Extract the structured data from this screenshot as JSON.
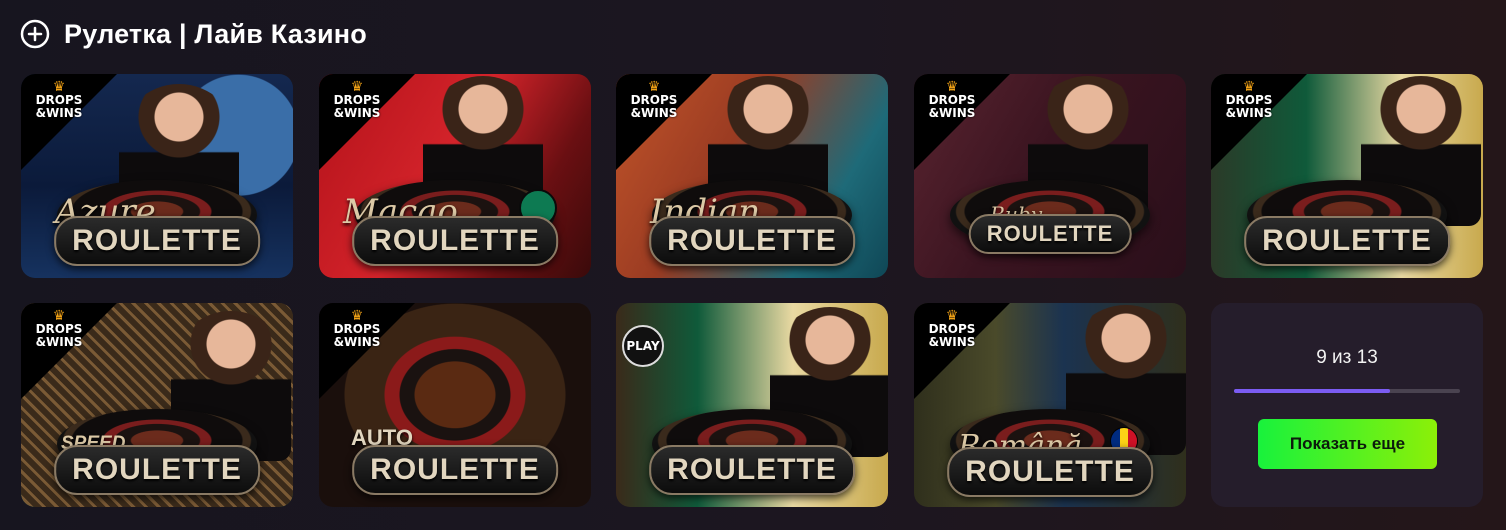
{
  "header": {
    "title": "Рулетка | Лайв Казино",
    "icon": "add-circle-icon"
  },
  "badges": {
    "drops_wins": "DROPS &WINS",
    "play": "PLAY"
  },
  "games": [
    {
      "prefix": "Azure",
      "title": "ROULETTE",
      "badge": "drops-wins"
    },
    {
      "prefix": "Macao",
      "title": "ROULETTE",
      "badge": "drops-wins"
    },
    {
      "prefix": "Indian",
      "title": "ROULETTE",
      "badge": "drops-wins"
    },
    {
      "prefix": "Ruby",
      "title": "ROULETTE",
      "badge": "drops-wins"
    },
    {
      "prefix": "",
      "title": "ROULETTE",
      "badge": "drops-wins"
    },
    {
      "prefix": "SPEED",
      "title": "ROULETTE",
      "badge": "drops-wins"
    },
    {
      "prefix": "AUTO",
      "title": "ROULETTE",
      "badge": "drops-wins"
    },
    {
      "prefix": "",
      "title": "ROULETTE",
      "badge": "play"
    },
    {
      "prefix": "Română",
      "title": "ROULETTE",
      "badge": "drops-wins"
    }
  ],
  "pagination": {
    "counter": "9 из 13",
    "shown": 9,
    "total": 13,
    "more_label": "Показать еще"
  },
  "colors": {
    "accent": "#7b5cf2",
    "button_start": "#18f23c",
    "button_end": "#8cf008",
    "panel": "#251d2b"
  }
}
